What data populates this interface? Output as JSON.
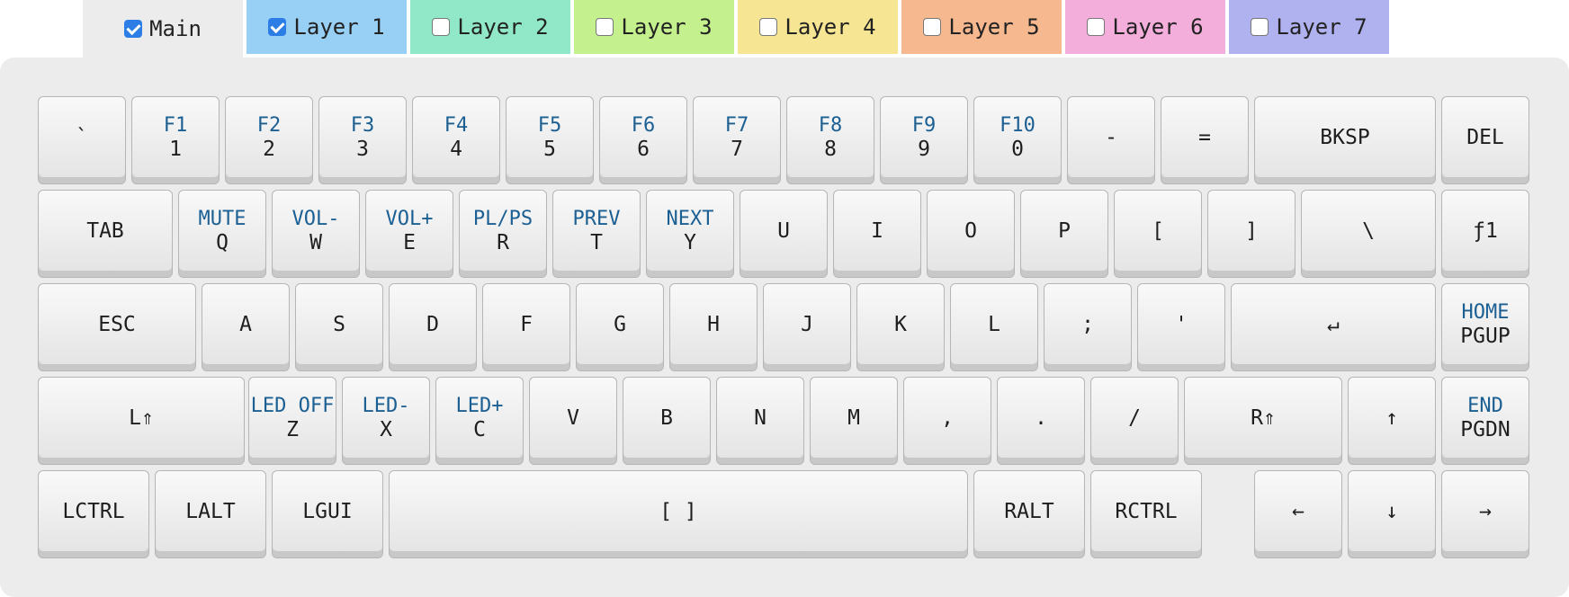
{
  "tabs": [
    {
      "label": "Main",
      "checked": true,
      "color": "#ececec"
    },
    {
      "label": "Layer 1",
      "checked": true,
      "color": "#98cff5"
    },
    {
      "label": "Layer 2",
      "checked": false,
      "color": "#90e8c8"
    },
    {
      "label": "Layer 3",
      "checked": false,
      "color": "#c5f08e"
    },
    {
      "label": "Layer 4",
      "checked": false,
      "color": "#f6e592"
    },
    {
      "label": "Layer 5",
      "checked": false,
      "color": "#f6b88f"
    },
    {
      "label": "Layer 6",
      "checked": false,
      "color": "#f3aedb"
    },
    {
      "label": "Layer 7",
      "checked": false,
      "color": "#b0b1ef"
    }
  ],
  "keyboard": {
    "rows": [
      [
        {
          "main": "`"
        },
        {
          "main": "1",
          "top": "F1"
        },
        {
          "main": "2",
          "top": "F2"
        },
        {
          "main": "3",
          "top": "F3"
        },
        {
          "main": "4",
          "top": "F4"
        },
        {
          "main": "5",
          "top": "F5"
        },
        {
          "main": "6",
          "top": "F6"
        },
        {
          "main": "7",
          "top": "F7"
        },
        {
          "main": "8",
          "top": "F8"
        },
        {
          "main": "9",
          "top": "F9"
        },
        {
          "main": "0",
          "top": "F10"
        },
        {
          "main": "-"
        },
        {
          "main": "="
        },
        {
          "main": "BKSP"
        },
        {
          "main": "DEL"
        }
      ],
      [
        {
          "main": "TAB"
        },
        {
          "main": "Q",
          "top": "MUTE"
        },
        {
          "main": "W",
          "top": "VOL-"
        },
        {
          "main": "E",
          "top": "VOL+"
        },
        {
          "main": "R",
          "top": "PL/PS"
        },
        {
          "main": "T",
          "top": "PREV"
        },
        {
          "main": "Y",
          "top": "NEXT"
        },
        {
          "main": "U"
        },
        {
          "main": "I"
        },
        {
          "main": "O"
        },
        {
          "main": "P"
        },
        {
          "main": "["
        },
        {
          "main": "]"
        },
        {
          "main": "\\"
        },
        {
          "main": "ƒ1"
        }
      ],
      [
        {
          "main": "ESC"
        },
        {
          "main": "A"
        },
        {
          "main": "S"
        },
        {
          "main": "D"
        },
        {
          "main": "F"
        },
        {
          "main": "G"
        },
        {
          "main": "H"
        },
        {
          "main": "J"
        },
        {
          "main": "K"
        },
        {
          "main": "L"
        },
        {
          "main": ";"
        },
        {
          "main": "'"
        },
        {
          "main": "↵"
        },
        {
          "main": "PGUP",
          "top": "HOME"
        }
      ],
      [
        {
          "main": "L⇑"
        },
        {
          "main": "Z",
          "top": "LED OFF"
        },
        {
          "main": "X",
          "top": "LED-"
        },
        {
          "main": "C",
          "top": "LED+"
        },
        {
          "main": "V"
        },
        {
          "main": "B"
        },
        {
          "main": "N"
        },
        {
          "main": "M"
        },
        {
          "main": ","
        },
        {
          "main": "."
        },
        {
          "main": "/"
        },
        {
          "main": "R⇑"
        },
        {
          "main": "↑"
        },
        {
          "main": "PGDN",
          "top": "END"
        }
      ],
      [
        {
          "main": "LCTRL"
        },
        {
          "main": "LALT"
        },
        {
          "main": "LGUI"
        },
        {
          "main": "[ ]"
        },
        {
          "main": "RALT"
        },
        {
          "main": "RCTRL"
        },
        {
          "main": "←"
        },
        {
          "main": "↓"
        },
        {
          "main": "→"
        }
      ]
    ]
  }
}
